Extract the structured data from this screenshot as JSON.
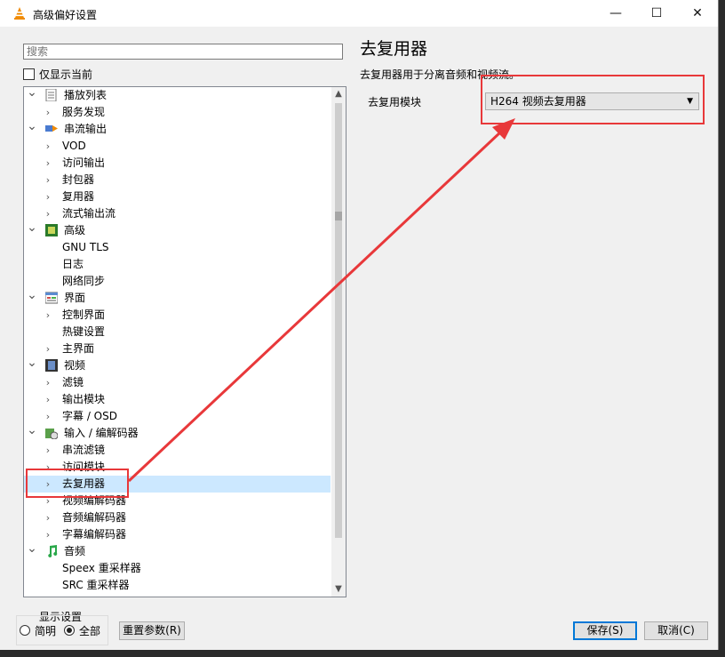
{
  "window": {
    "title": "高级偏好设置",
    "minimize_glyph": "—",
    "maximize_glyph": "☐",
    "close_glyph": "✕"
  },
  "sidebar": {
    "search_placeholder": "搜索",
    "show_current_only_label": "仅显示当前",
    "tree": [
      {
        "label": "播放列表",
        "level": 0,
        "expanded": true,
        "icon": "playlist-icon"
      },
      {
        "label": "服务发现",
        "level": 1,
        "has_children": true
      },
      {
        "label": "串流输出",
        "level": 0,
        "expanded": true,
        "icon": "stream-output-icon"
      },
      {
        "label": "VOD",
        "level": 1,
        "has_children": true
      },
      {
        "label": "访问输出",
        "level": 1,
        "has_children": true
      },
      {
        "label": "封包器",
        "level": 1,
        "has_children": true
      },
      {
        "label": "复用器",
        "level": 1,
        "has_children": true
      },
      {
        "label": "流式输出流",
        "level": 1,
        "has_children": true
      },
      {
        "label": "高级",
        "level": 0,
        "expanded": true,
        "icon": "chip-icon"
      },
      {
        "label": "GNU TLS",
        "level": 1,
        "has_children": false
      },
      {
        "label": "日志",
        "level": 1,
        "has_children": false
      },
      {
        "label": "网络同步",
        "level": 1,
        "has_children": false
      },
      {
        "label": "界面",
        "level": 0,
        "expanded": true,
        "icon": "interface-icon"
      },
      {
        "label": "控制界面",
        "level": 1,
        "has_children": true
      },
      {
        "label": "热键设置",
        "level": 1,
        "has_children": false
      },
      {
        "label": "主界面",
        "level": 1,
        "has_children": true
      },
      {
        "label": "视频",
        "level": 0,
        "expanded": true,
        "icon": "film-icon"
      },
      {
        "label": "滤镜",
        "level": 1,
        "has_children": true
      },
      {
        "label": "输出模块",
        "level": 1,
        "has_children": true
      },
      {
        "label": "字幕 / OSD",
        "level": 1,
        "has_children": true
      },
      {
        "label": "输入 / 编解码器",
        "level": 0,
        "expanded": true,
        "icon": "codec-icon"
      },
      {
        "label": "串流滤镜",
        "level": 1,
        "has_children": true
      },
      {
        "label": "访问模块",
        "level": 1,
        "has_children": true
      },
      {
        "label": "去复用器",
        "level": 1,
        "has_children": true,
        "selected": true
      },
      {
        "label": "视频编解码器",
        "level": 1,
        "has_children": true
      },
      {
        "label": "音频编解码器",
        "level": 1,
        "has_children": true
      },
      {
        "label": "字幕编解码器",
        "level": 1,
        "has_children": true
      },
      {
        "label": "音频",
        "level": 0,
        "expanded": true,
        "icon": "music-note-icon"
      },
      {
        "label": "Speex 重采样器",
        "level": 1,
        "has_children": false
      },
      {
        "label": "SRC 重采样器",
        "level": 1,
        "has_children": false
      }
    ],
    "scroll_position": 0.38
  },
  "panel": {
    "title": "去复用器",
    "description": "去复用器用于分离音频和视频流。",
    "module_label": "去复用模块",
    "module_value": "H264 视频去复用器"
  },
  "footer": {
    "display_settings_label": "显示设置",
    "radio_simple": "简明",
    "radio_all": "全部",
    "selected": "all",
    "reset_button": "重置参数(R)",
    "save_button": "保存(S)",
    "cancel_button": "取消(C)"
  },
  "colors": {
    "annotation": "#e8383a",
    "selection": "#cce8ff",
    "accent": "#0078d7"
  }
}
